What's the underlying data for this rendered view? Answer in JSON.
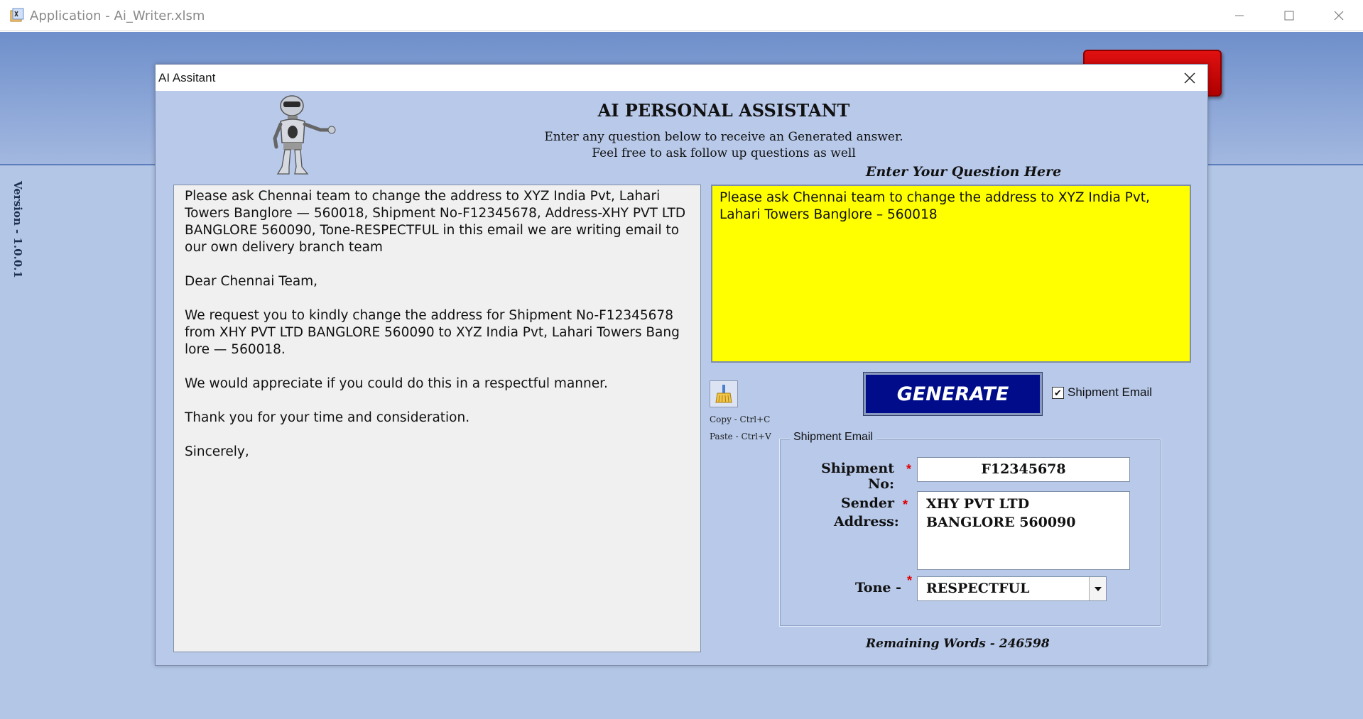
{
  "app": {
    "title": "Application - Ai_Writer.xlsm",
    "version": "Version - 1.0.0.1"
  },
  "dialog": {
    "title": "AI Assitant",
    "heading": "AI PERSONAL ASSISTANT",
    "subtitle_line1": "Enter any question below to receive an Generated answer.",
    "subtitle_line2": "Feel free to ask follow up questions as well",
    "question_label": "Enter Your Question Here"
  },
  "answer": {
    "paragraphs": [
      "Please ask Chennai team to change the address to XYZ India Pvt, Lahari Towers Banglore — 560018, Shipment No-F12345678, Address-XHY PVT LTD BANGLORE 560090, Tone-RESPECTFUL in this email we are writing email to our own delivery branch team",
      "Dear Chennai Team,",
      "We request you to kindly change the address for Shipment No-F12345678 from XHY PVT LTD BANGLORE 560090 to XYZ India Pvt, Lahari Towers Bang lore — 560018.",
      "We would appreciate if you could do this in a respectful manner.",
      "Thank you for your time and consideration.",
      "Sincerely,"
    ]
  },
  "question": {
    "value": "Please ask Chennai team to change the address to XYZ India Pvt, Lahari Towers Banglore – 560018"
  },
  "controls": {
    "copy_hint": "Copy - Ctrl+C",
    "paste_hint": "Paste - Ctrl+V",
    "generate_label": "GENERATE",
    "shipment_email_checkbox_label": "Shipment Email",
    "shipment_email_checked": true,
    "remaining_words": "Remaining Words - 246598"
  },
  "shipment_frame": {
    "legend": "Shipment Email",
    "shipment_no_label": "Shipment No:",
    "shipment_no_value": "F12345678",
    "sender_label_line1": "Sender",
    "sender_label_line2": "Address:",
    "sender_value": "XHY PVT LTD BANGLORE 560090",
    "tone_label": "Tone -",
    "tone_value": "RESPECTFUL",
    "required_mark": "*"
  },
  "colors": {
    "dialog_bg": "#b8c9ea",
    "question_bg": "#ffff00",
    "generate_bg": "#000c8a",
    "required": "#e00000"
  }
}
